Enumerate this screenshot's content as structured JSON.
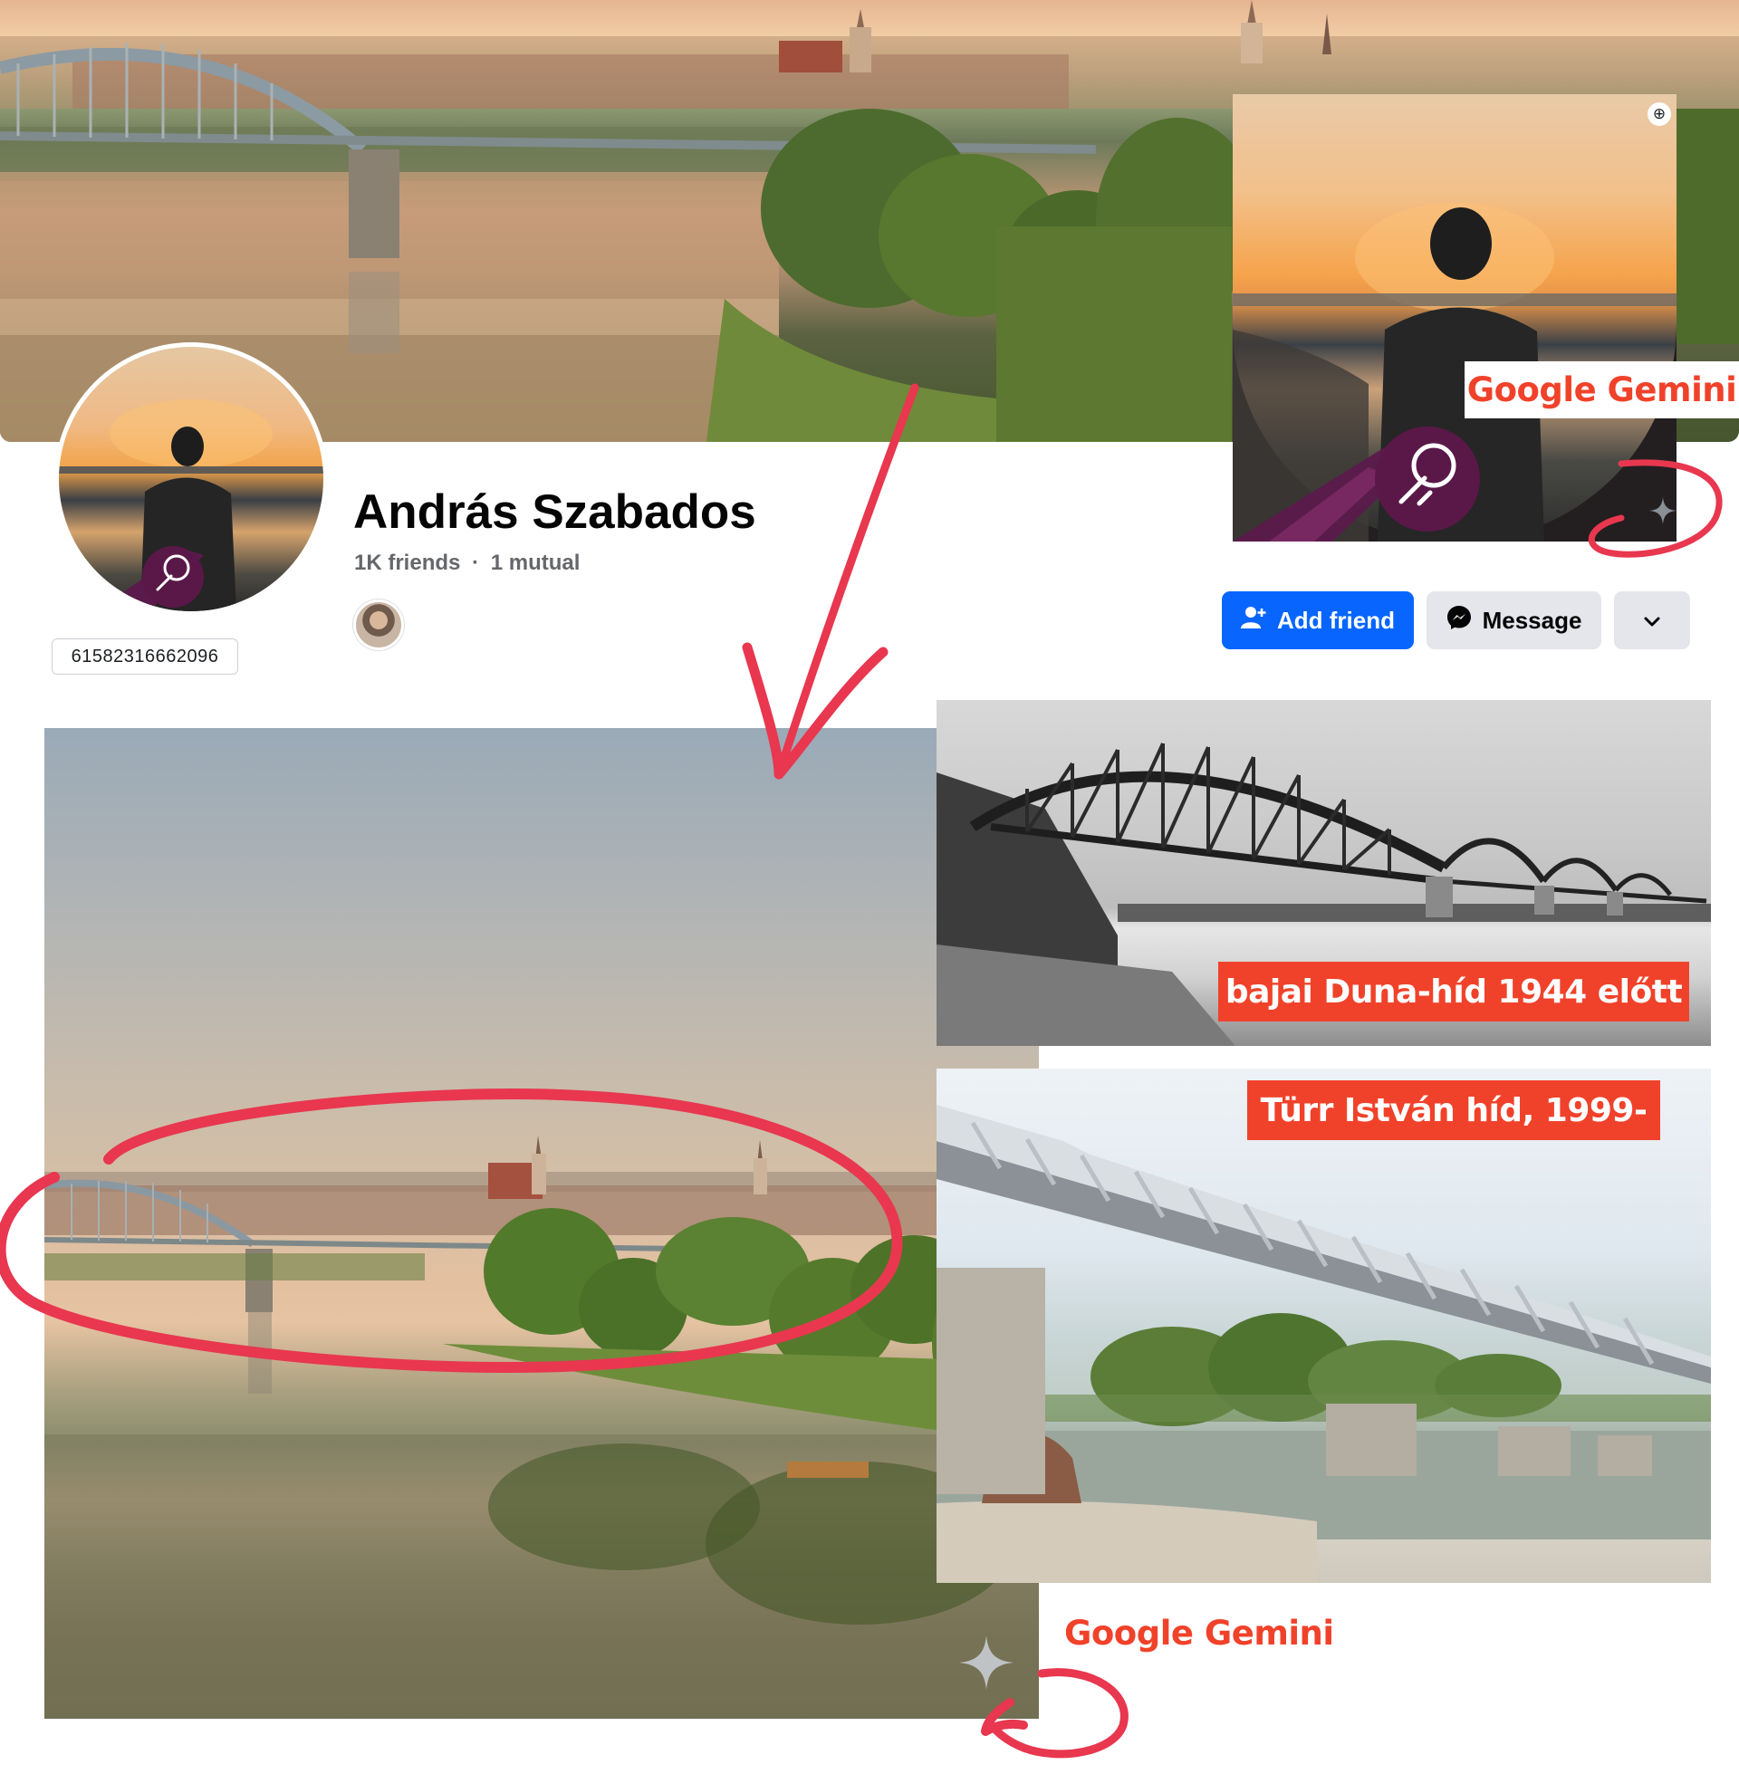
{
  "profile": {
    "name": "András Szabados",
    "friends_count": "1K friends",
    "separator": "·",
    "mutual": "1 mutual",
    "user_id": "61582316662096"
  },
  "actions": {
    "add_friend_label": "Add friend",
    "message_label": "Message",
    "more_icon": "chevron-down-icon"
  },
  "annotations": {
    "gemini_label_top": "Google Gemini",
    "gemini_label_bottom": "Google Gemini",
    "historic_bridge_caption": "bajai Duna-híd 1944 előtt",
    "modern_bridge_caption": "Türr István híd, 1999-"
  },
  "icons": {
    "zoom": "zoom-in-icon",
    "sparkle": "gemini-sparkle-icon",
    "badge": "astronaut-badge-icon",
    "messenger": "messenger-icon",
    "add_person": "add-person-icon"
  },
  "colors": {
    "accent_blue": "#0866ff",
    "annotation_red": "#f0422a",
    "marker_red": "#e8374f",
    "button_gray": "#e4e6eb",
    "secondary_text": "#65676b"
  }
}
